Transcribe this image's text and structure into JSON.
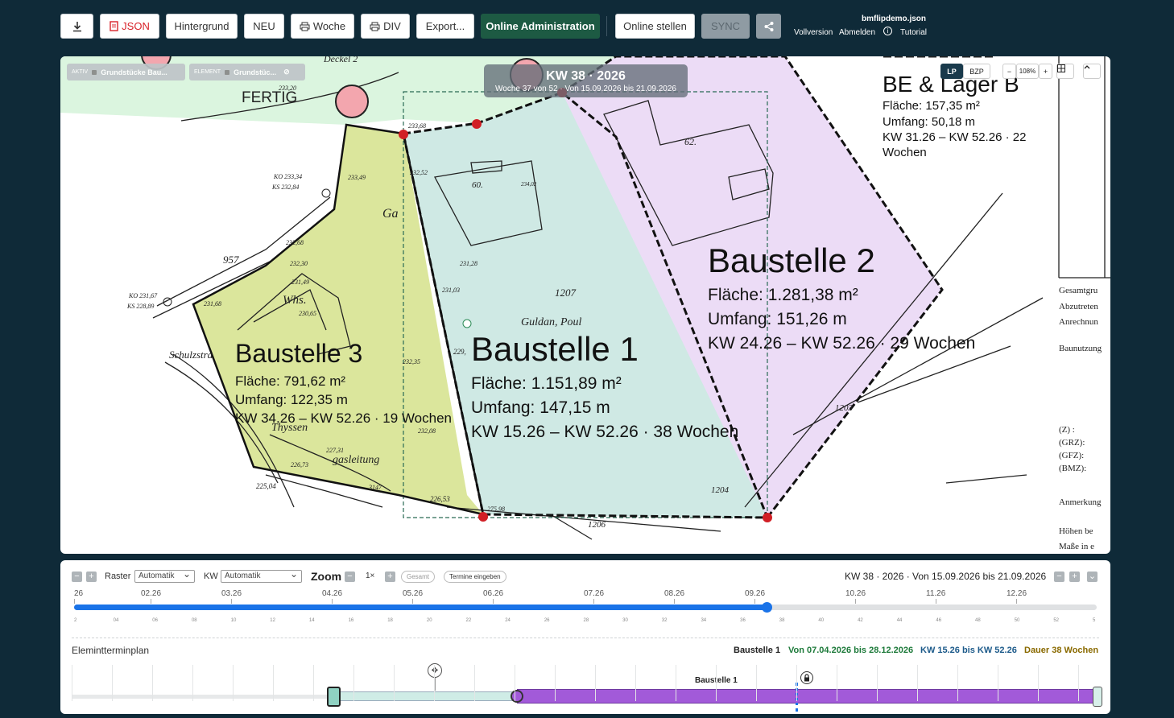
{
  "toolbar": {
    "json": "JSON",
    "hintergrund": "Hintergrund",
    "neu": "NEU",
    "woche": "Woche",
    "div": "DIV",
    "export": "Export...",
    "online_admin": "Online Administration",
    "online_stellen": "Online stellen",
    "sync": "SYNC"
  },
  "file_info": {
    "filename": "bmflipdemo.json",
    "vollversion": "Vollversion",
    "abmelden": "Abmelden",
    "tutorial": "Tutorial"
  },
  "map": {
    "chip_aktiv": {
      "tag": "AKTIV",
      "label": "Grundstücke Bau..."
    },
    "chip_element": {
      "tag": "ELEMENT",
      "label": "Grundstüc..."
    },
    "week_title": "KW 38 · 2026",
    "week_sub": "Woche 37 von 52 · Von 15.09.2026 bis 21.09.2026",
    "zoom": {
      "lp": "LP",
      "bzp": "BZP",
      "minus": "−",
      "level": "108%",
      "plus": "+"
    },
    "fertig": "FERTIG",
    "sites": [
      {
        "title": "Baustelle 1",
        "flaeche": "Fläche: 1.151,89 m²",
        "umfang": "Umfang: 147,15 m",
        "kw": "KW 15.26 – KW 52.26 · 38 Wochen"
      },
      {
        "title": "Baustelle 2",
        "flaeche": "Fläche: 1.281,38 m²",
        "umfang": "Umfang: 151,26 m",
        "kw": "KW 24.26 – KW 52.26 · 29 Wochen"
      },
      {
        "title": "Baustelle 3",
        "flaeche": "Fläche: 791,62 m²",
        "umfang": "Umfang: 122,35 m",
        "kw": "KW 34.26 – KW 52.26 · 19 Wochen"
      }
    ],
    "lager": {
      "title": "BE & Lager B",
      "flaeche": "Fläche: 157,35 m²",
      "umfang": "Umfang: 50,18 m",
      "kw1": "KW 31.26 – KW 52.26 · 22",
      "kw2": "Wochen"
    },
    "plan_labels": [
      "Deckel 2",
      "Ga",
      "Whs.",
      "Guldan, Poul",
      "1207",
      "1203",
      "1204",
      "1206",
      "60.",
      "62.",
      "957",
      "Schulzstra",
      "Thyssen",
      "gasleitung",
      "3147",
      "225,04",
      "226,53",
      "275,98",
      "227,31",
      "226,73",
      "233,49",
      "233,20",
      "233,68",
      "232,52",
      "231,28",
      "231,03",
      "232,68",
      "232,30",
      "231,49",
      "230,65",
      "231,68",
      "232,35",
      "232,08",
      "KO 233,34",
      "KS 232,84",
      "KO 231,67",
      "KS 228,89",
      "234,02",
      "229,"
    ],
    "legend_right": [
      "Gesamtgru",
      "Abzutreten",
      "Anrechnun",
      "Baunutzung",
      "(Z)       :",
      "(GRZ):",
      "(GFZ):",
      "(BMZ):",
      "Anmerkung",
      "Höhen be",
      "Maße in e"
    ]
  },
  "timeline": {
    "raster_label": "Raster",
    "raster_value": "Automatik",
    "kw_label": "KW",
    "kw_value": "Automatik",
    "zoom_label": "Zoom",
    "zoom_value": "1×",
    "gesamt": "Gesamt",
    "termine": "Termine eingeben",
    "current_week": "KW 38 · 2026 · Von 15.09.2026 bis 21.09.2026",
    "months": [
      "26",
      "02.26",
      "03.26",
      "04.26",
      "05.26",
      "06.26",
      "07.26",
      "08.26",
      "09.26",
      "10.26",
      "11.26",
      "12.26"
    ],
    "weeks": [
      "2",
      "04",
      "06",
      "08",
      "10",
      "12",
      "14",
      "16",
      "18",
      "20",
      "22",
      "24",
      "26",
      "28",
      "30",
      "32",
      "34",
      "36",
      "38",
      "40",
      "42",
      "44",
      "46",
      "48",
      "50",
      "52",
      "5"
    ],
    "progress_week": 38,
    "total_weeks": 52
  },
  "element_plan": {
    "title": "Elemintterminplan",
    "site": "Baustelle 1",
    "von": "Von 07.04.2026 bis 28.12.2026",
    "kw": "KW 15.26 bis KW 52.26",
    "dauer": "Dauer 38 Wochen",
    "bar_label": "Baustelle 1"
  },
  "colors": {
    "bg": "#0f2a38",
    "green_btn": "#1d5a43",
    "site1": "#cdeae5",
    "site2": "#ead8f5",
    "site3": "#dde7a0",
    "progress": "#1a73e8",
    "bar_purple": "#a25ad9"
  }
}
